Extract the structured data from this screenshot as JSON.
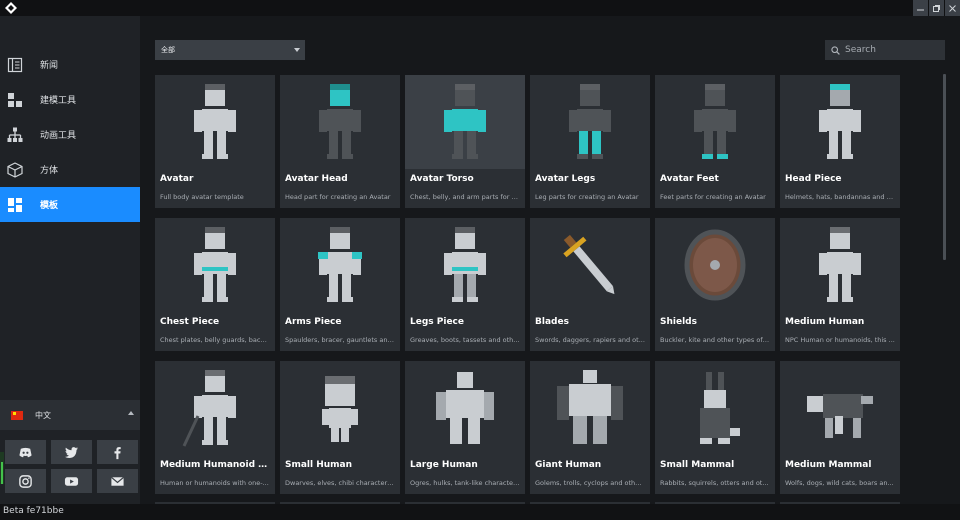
{
  "sidebar": {
    "items": [
      {
        "label": "新闻",
        "icon": "news-icon"
      },
      {
        "label": "建模工具",
        "icon": "modeling-tool-icon"
      },
      {
        "label": "动画工具",
        "icon": "animation-tool-icon"
      },
      {
        "label": "方体",
        "icon": "cube-icon"
      },
      {
        "label": "模板",
        "icon": "templates-icon",
        "active": true
      }
    ],
    "language": {
      "label": "中文",
      "flag": "china-flag-icon"
    },
    "social": [
      "discord-icon",
      "twitter-icon",
      "facebook-icon",
      "instagram-icon",
      "youtube-icon",
      "email-icon"
    ]
  },
  "filter": {
    "selected": "全部"
  },
  "search": {
    "placeholder": "Search"
  },
  "status": {
    "text": "Beta fe71bbe"
  },
  "colors": {
    "accent": "#1a8cff",
    "highlight": "#2ec4c4",
    "card_bg": "#2b2f34",
    "sidebar_bg": "#1f2226"
  },
  "templates": [
    {
      "title": "Avatar",
      "desc": "Full body avatar template",
      "thumb": "avatar"
    },
    {
      "title": "Avatar Head",
      "desc": "Head part for creating an Avatar",
      "thumb": "avatar-head"
    },
    {
      "title": "Avatar Torso",
      "desc": "Chest, belly, and arm parts for cr...",
      "thumb": "avatar-torso"
    },
    {
      "title": "Avatar Legs",
      "desc": "Leg parts for creating an Avatar",
      "thumb": "avatar-legs"
    },
    {
      "title": "Avatar Feet",
      "desc": "Feet parts for creating an Avatar",
      "thumb": "avatar-feet"
    },
    {
      "title": "Head Piece",
      "desc": "Helmets, hats, bandannas and a...",
      "thumb": "head-piece"
    },
    {
      "title": "Chest Piece",
      "desc": "Chest plates, belly guards, back...",
      "thumb": "chest-piece"
    },
    {
      "title": "Arms Piece",
      "desc": "Spaulders, bracer, gauntlets and...",
      "thumb": "arms-piece"
    },
    {
      "title": "Legs Piece",
      "desc": "Greaves, boots, tassets and oth...",
      "thumb": "legs-piece"
    },
    {
      "title": "Blades",
      "desc": "Swords, daggers, rapiers and ot...",
      "thumb": "blade"
    },
    {
      "title": "Shields",
      "desc": "Buckler, kite and other types of ...",
      "thumb": "shield"
    },
    {
      "title": "Medium Human",
      "desc": "NPC Human or humanoids, this ...",
      "thumb": "medium-human"
    },
    {
      "title": "Medium Humanoid War...",
      "desc": "Human or humanoids with one-...",
      "thumb": "humanoid-warrior"
    },
    {
      "title": "Small Human",
      "desc": "Dwarves, elves, chibi characters...",
      "thumb": "small-human"
    },
    {
      "title": "Large Human",
      "desc": "Ogres, hulks, tank-like character...",
      "thumb": "large-human"
    },
    {
      "title": "Giant Human",
      "desc": "Golems, trolls, cyclops and othe...",
      "thumb": "giant-human"
    },
    {
      "title": "Small Mammal",
      "desc": "Rabbits, squirrels, otters and ot...",
      "thumb": "small-mammal"
    },
    {
      "title": "Medium Mammal",
      "desc": "Wolfs, dogs, wild cats, boars an...",
      "thumb": "medium-mammal"
    }
  ]
}
